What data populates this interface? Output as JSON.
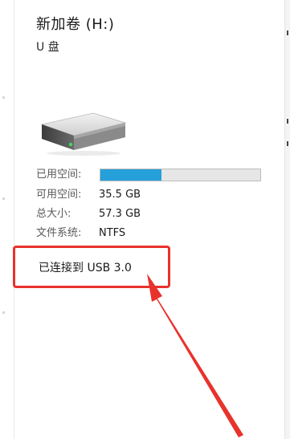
{
  "drive": {
    "title": "新加卷 (H:)",
    "subtitle": "U 盘",
    "icon": "usb-drive-icon"
  },
  "details": {
    "used_label": "已用空间:",
    "used_fraction": 0.38,
    "free_label": "可用空间:",
    "free_value": "35.5 GB",
    "total_label": "总大小:",
    "total_value": "57.3 GB",
    "fs_label": "文件系统:",
    "fs_value": "NTFS"
  },
  "connection": {
    "text": "已连接到 USB 3.0"
  },
  "colors": {
    "usage_fill": "#26a0da",
    "highlight": "#e8322c"
  }
}
